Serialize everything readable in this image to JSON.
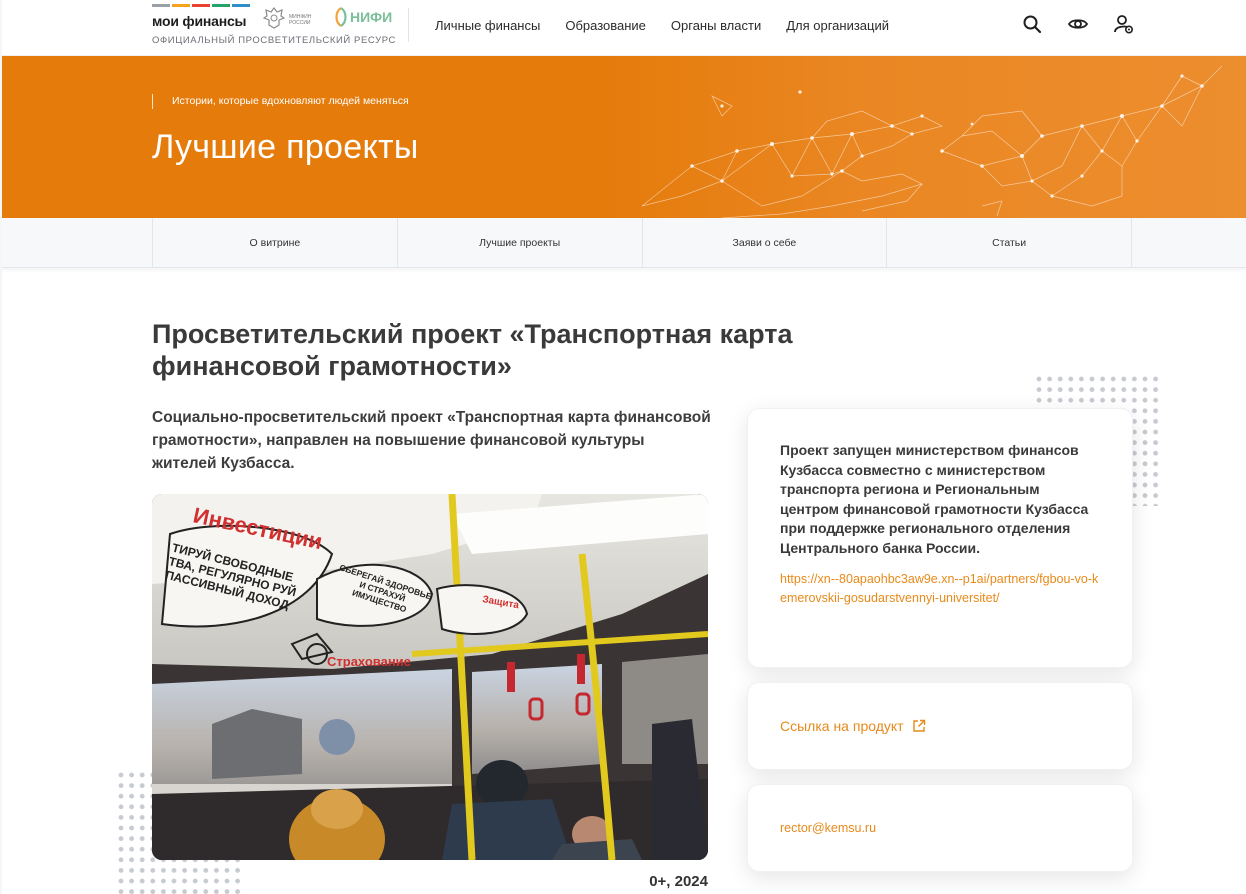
{
  "brand": {
    "logo_text": "мои финансы",
    "subtitle": "ОФИЦИАЛЬНЫЙ ПРОСВЕТИТЕЛЬСКИЙ РЕСУРС",
    "minfin_label": "МИНФИН РОССИИ",
    "nifi_label": "НИФИ",
    "stripe_colors": [
      "#9aa0a6",
      "#f7a21b",
      "#e8432f",
      "#25a36a",
      "#2f8ec9",
      "#8fc7c0"
    ]
  },
  "nav": {
    "items": [
      "Личные финансы",
      "Образование",
      "Органы власти",
      "Для организаций"
    ],
    "icons": [
      "search-icon",
      "eye-icon",
      "user-settings-icon"
    ]
  },
  "hero": {
    "kicker": "Истории, которые вдохновляют людей меняться",
    "title": "Лучшие проекты",
    "bg_color": "#e57b0b"
  },
  "subnav": {
    "items": [
      "О витрине",
      "Лучшие проекты",
      "Заяви о себе",
      "Статьи"
    ]
  },
  "article": {
    "title": "Просветительский проект «Транспортная карта финансовой грамотности»",
    "lead": "Социально-просветительский проект «Транспортная карта финансовой грамотности», направлен на повышение финансовой культуры жителей Кузбасса.",
    "photo_labels": {
      "investments": "Инвестиции",
      "bubble_left": "ТИРУЙ СВОБОДНЫЕ ТВА, РЕГУЛЯРНО РУЙ ПАССИВНЫЙ ДОХОД",
      "bubble_mid": "СБЕРЕГАЙ ЗДОРОВЬЕ И СТРАХУЙ ИМУЩЕСТВО",
      "insurance": "Страхование",
      "protection": "Защита"
    },
    "age_year": "0+, 2024"
  },
  "info": {
    "description": "Проект запущен министерством финансов Кузбасса совместно с министерством транспорта региона и Региональным центром финансовой грамотности Кузбасса при поддержке регионального отделения Центрального банка России.",
    "url": "https://xn--80apaohbc3aw9e.xn--p1ai/partners/fgbou-vo-kemerovskii-gosudarstvennyi-universitet/",
    "product_link": "Ссылка на продукт",
    "email": "rector@kemsu.ru",
    "accent": "#e58a1b"
  }
}
